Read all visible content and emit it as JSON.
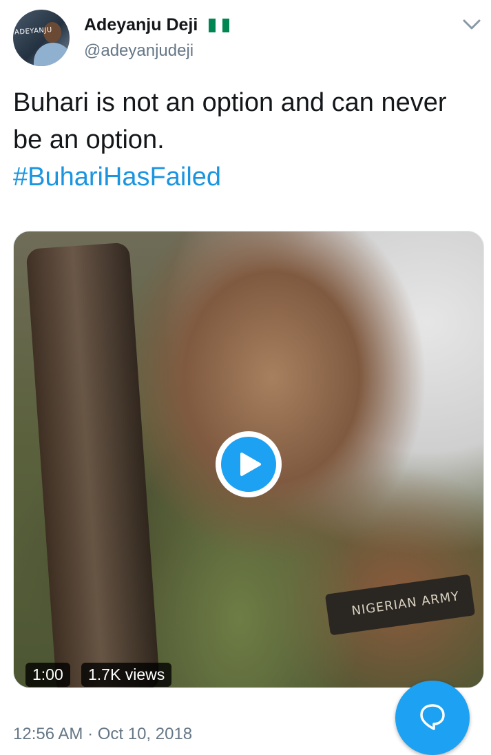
{
  "tweet": {
    "author": {
      "name": "Adeyanju Deji",
      "handle": "@adeyanjudeji",
      "avatar_text": "ADEYANJU",
      "flag_icon": "nigeria-flag-icon"
    },
    "menu_icon": "chevron-down-icon",
    "text": "Buhari is not an option and can never be an option.",
    "hashtag": "#BuhariHasFailed",
    "media": {
      "type": "video",
      "duration": "1:00",
      "views": "1.7K views",
      "patch_text": "NIGERIAN ARMY",
      "play_icon": "play-icon"
    },
    "timestamp": "12:56 AM · Oct 10, 2018"
  },
  "fab": {
    "icon": "compose-bubble-icon"
  },
  "colors": {
    "accent": "#1da1f2",
    "hashtag": "#1b95e0",
    "secondary_text": "#657786",
    "primary_text": "#14171a"
  }
}
